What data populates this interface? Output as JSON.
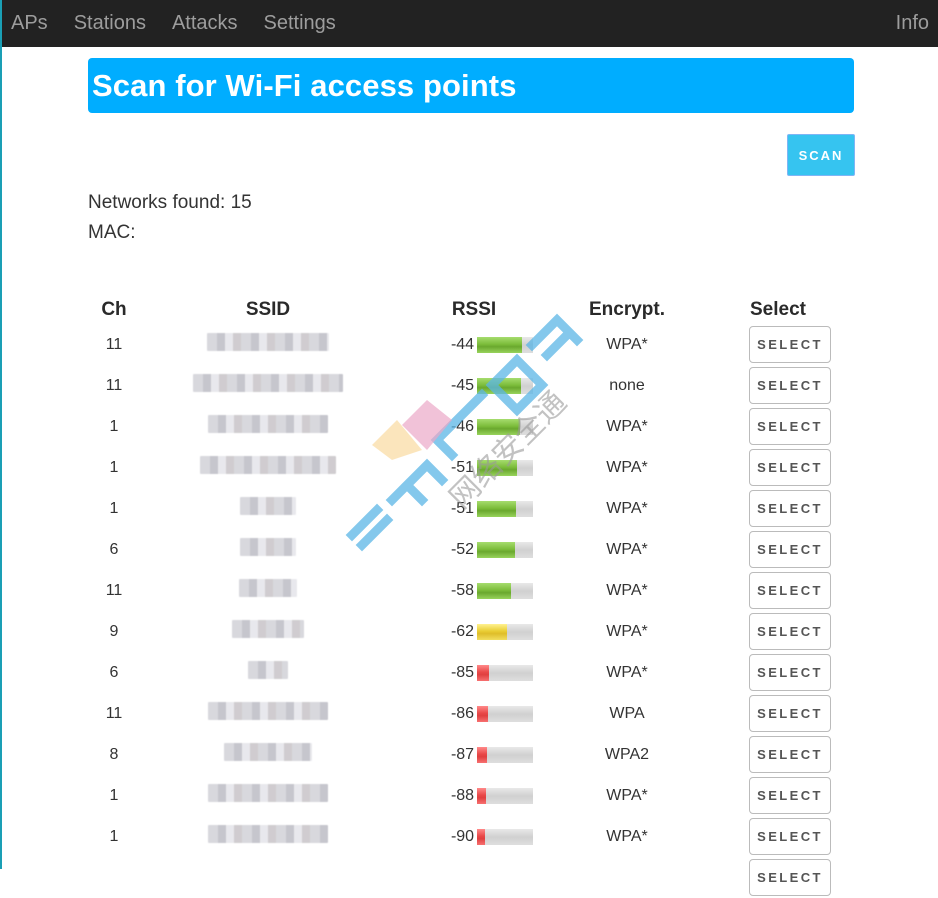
{
  "nav": {
    "items": [
      "APs",
      "Stations",
      "Attacks",
      "Settings"
    ],
    "right_item": "Info"
  },
  "header": {
    "title": "Scan for Wi-Fi access points"
  },
  "scan_button": {
    "label": "SCAN"
  },
  "info": {
    "networks_found": "Networks found: 15",
    "mac": "MAC:"
  },
  "table": {
    "columns": [
      "Ch",
      "SSID",
      "RSSI",
      "Encrypt.",
      "Select"
    ],
    "select_label": "SELECT",
    "rows": [
      {
        "ch": "11",
        "ssid": "[redacted]",
        "rssi": "-44",
        "signal_pct": 80,
        "level": "green",
        "enc": "WPA*"
      },
      {
        "ch": "11",
        "ssid": "[redacted]",
        "rssi": "-45",
        "signal_pct": 79,
        "level": "green",
        "enc": "none"
      },
      {
        "ch": "1",
        "ssid": "[redacted]",
        "rssi": "-46",
        "signal_pct": 77,
        "level": "green",
        "enc": "WPA*"
      },
      {
        "ch": "1",
        "ssid": "[redacted]",
        "rssi": "-51",
        "signal_pct": 72,
        "level": "green",
        "enc": "WPA*"
      },
      {
        "ch": "1",
        "ssid": "[redacted]",
        "rssi": "-51",
        "signal_pct": 70,
        "level": "green",
        "enc": "WPA*"
      },
      {
        "ch": "6",
        "ssid": "[redacted]",
        "rssi": "-52",
        "signal_pct": 68,
        "level": "green",
        "enc": "WPA*"
      },
      {
        "ch": "11",
        "ssid": "[redacted]",
        "rssi": "-58",
        "signal_pct": 61,
        "level": "green",
        "enc": "WPA*"
      },
      {
        "ch": "9",
        "ssid": "[redacted]",
        "rssi": "-62",
        "signal_pct": 54,
        "level": "yellow",
        "enc": "WPA*"
      },
      {
        "ch": "6",
        "ssid": "[redacted]",
        "rssi": "-85",
        "signal_pct": 22,
        "level": "red",
        "enc": "WPA*"
      },
      {
        "ch": "11",
        "ssid": "[redacted]",
        "rssi": "-86",
        "signal_pct": 20,
        "level": "red",
        "enc": "WPA"
      },
      {
        "ch": "8",
        "ssid": "[redacted]",
        "rssi": "-87",
        "signal_pct": 18,
        "level": "red",
        "enc": "WPA2"
      },
      {
        "ch": "1",
        "ssid": "[redacted]",
        "rssi": "-88",
        "signal_pct": 16,
        "level": "red",
        "enc": "WPA*"
      },
      {
        "ch": "1",
        "ssid": "[redacted]",
        "rssi": "-90",
        "signal_pct": 14,
        "level": "red",
        "enc": "WPA*"
      },
      {
        "ch": "",
        "ssid": "",
        "rssi": "",
        "signal_pct": 0,
        "level": "red",
        "enc": ""
      }
    ]
  },
  "watermark": {
    "text": "网络安全通"
  }
}
